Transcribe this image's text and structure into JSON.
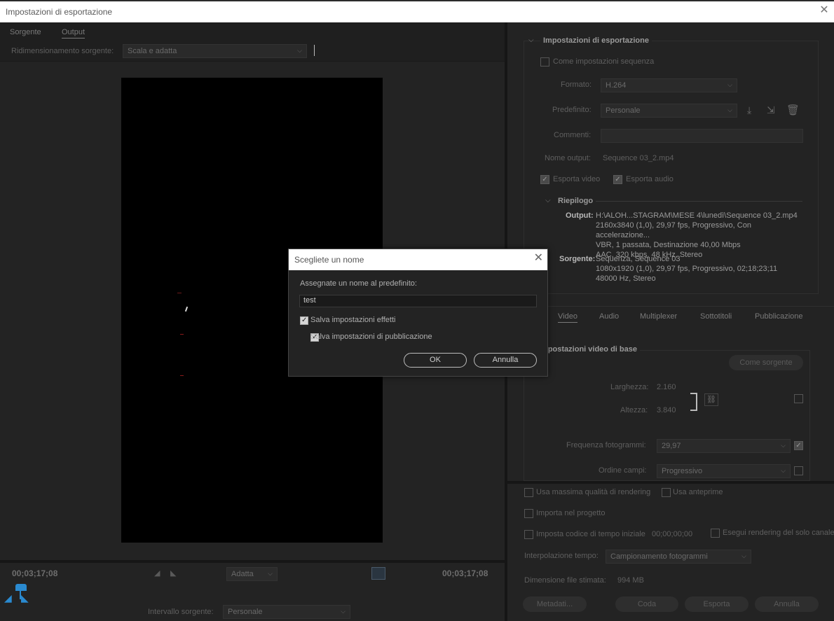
{
  "window": {
    "title": "Impostazioni di esportazione",
    "close_icon": "close-icon"
  },
  "left": {
    "tabs": [
      {
        "label": "Sorgente"
      },
      {
        "label": "Output"
      }
    ],
    "resize_label": "Ridimensionamento sorgente:",
    "resize_value": "Scala e adatta",
    "timecode_start": "00;03;17;08",
    "timecode_end": "00;03;17;08",
    "fit_value": "Adatta",
    "interval_label": "Intervallo sorgente:",
    "interval_value": "Personale"
  },
  "export": {
    "section_title": "Impostazioni di esportazione",
    "match_sequence": "Come impostazioni sequenza",
    "format_label": "Formato:",
    "format_value": "H.264",
    "preset_label": "Predefinito:",
    "preset_value": "Personale",
    "comments_label": "Commenti:",
    "output_name_label": "Nome output:",
    "output_name_value": "Sequence 03_2.mp4",
    "export_video": "Esporta video",
    "export_audio": "Esporta audio",
    "summary_title": "Riepilogo",
    "output_label": "Output:",
    "output_lines": [
      "H:\\ALOH...STAGRAM\\MESE 4\\lunedì\\Sequence 03_2.mp4",
      "2160x3840 (1,0), 29,97 fps, Progressivo, Con accelerazione...",
      "VBR, 1 passata, Destinazione 40,00 Mbps",
      "AAC, 320 kbps, 48 kHz, Stereo"
    ],
    "source_label": "Sorgente:",
    "source_lines": [
      "Sequenza, Sequence 03",
      "1080x1920 (1,0), 29,97 fps, Progressivo, 02;18;23;11",
      "48000 Hz, Stereo"
    ]
  },
  "video_tabs": [
    {
      "label": "Video"
    },
    {
      "label": "Audio"
    },
    {
      "label": "Multiplexer"
    },
    {
      "label": "Sottotitoli"
    },
    {
      "label": "Pubblicazione"
    }
  ],
  "video": {
    "section_title": "Impostazioni video di base",
    "match_source": "Come sorgente",
    "width_label": "Larghezza:",
    "width_value": "2.160",
    "height_label": "Altezza:",
    "height_value": "3.840",
    "fps_label": "Frequenza fotogrammi:",
    "fps_value": "29,97",
    "field_order_label": "Ordine campi:",
    "field_order_value": "Progressivo"
  },
  "options": {
    "max_quality": "Usa massima qualità di rendering",
    "use_previews": "Usa anteprime",
    "import_project": "Importa nel progetto",
    "set_timecode": "Imposta codice di tempo iniziale",
    "timecode_value": "00;00;00;00",
    "render_alpha": "Esegui rendering del solo canale",
    "interp_label": "Interpolazione tempo:",
    "interp_value": "Campionamento fotogrammi",
    "filesize_label": "Dimensione file stimata:",
    "filesize_value": "994 MB",
    "buttons": {
      "metadata": "Metadati...",
      "queue": "Coda",
      "export": "Esporta",
      "cancel": "Annulla"
    }
  },
  "dialog": {
    "title": "Scegliete un nome",
    "prompt": "Assegnate un nome al predefinito:",
    "name_value": "test",
    "save_effects": "Salva impostazioni effetti",
    "save_publish": "Salva impostazioni di pubblicazione",
    "ok": "OK",
    "cancel": "Annulla"
  }
}
